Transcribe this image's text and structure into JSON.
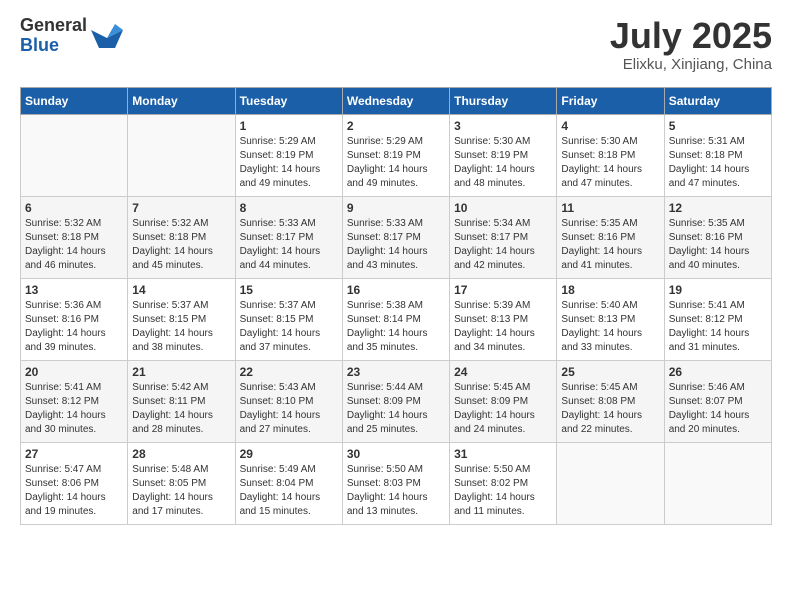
{
  "logo": {
    "general": "General",
    "blue": "Blue"
  },
  "title": "July 2025",
  "location": "Elixku, Xinjiang, China",
  "header_days": [
    "Sunday",
    "Monday",
    "Tuesday",
    "Wednesday",
    "Thursday",
    "Friday",
    "Saturday"
  ],
  "weeks": [
    [
      {
        "day": "",
        "sunrise": "",
        "sunset": "",
        "daylight": ""
      },
      {
        "day": "",
        "sunrise": "",
        "sunset": "",
        "daylight": ""
      },
      {
        "day": "1",
        "sunrise": "Sunrise: 5:29 AM",
        "sunset": "Sunset: 8:19 PM",
        "daylight": "Daylight: 14 hours and 49 minutes."
      },
      {
        "day": "2",
        "sunrise": "Sunrise: 5:29 AM",
        "sunset": "Sunset: 8:19 PM",
        "daylight": "Daylight: 14 hours and 49 minutes."
      },
      {
        "day": "3",
        "sunrise": "Sunrise: 5:30 AM",
        "sunset": "Sunset: 8:19 PM",
        "daylight": "Daylight: 14 hours and 48 minutes."
      },
      {
        "day": "4",
        "sunrise": "Sunrise: 5:30 AM",
        "sunset": "Sunset: 8:18 PM",
        "daylight": "Daylight: 14 hours and 47 minutes."
      },
      {
        "day": "5",
        "sunrise": "Sunrise: 5:31 AM",
        "sunset": "Sunset: 8:18 PM",
        "daylight": "Daylight: 14 hours and 47 minutes."
      }
    ],
    [
      {
        "day": "6",
        "sunrise": "Sunrise: 5:32 AM",
        "sunset": "Sunset: 8:18 PM",
        "daylight": "Daylight: 14 hours and 46 minutes."
      },
      {
        "day": "7",
        "sunrise": "Sunrise: 5:32 AM",
        "sunset": "Sunset: 8:18 PM",
        "daylight": "Daylight: 14 hours and 45 minutes."
      },
      {
        "day": "8",
        "sunrise": "Sunrise: 5:33 AM",
        "sunset": "Sunset: 8:17 PM",
        "daylight": "Daylight: 14 hours and 44 minutes."
      },
      {
        "day": "9",
        "sunrise": "Sunrise: 5:33 AM",
        "sunset": "Sunset: 8:17 PM",
        "daylight": "Daylight: 14 hours and 43 minutes."
      },
      {
        "day": "10",
        "sunrise": "Sunrise: 5:34 AM",
        "sunset": "Sunset: 8:17 PM",
        "daylight": "Daylight: 14 hours and 42 minutes."
      },
      {
        "day": "11",
        "sunrise": "Sunrise: 5:35 AM",
        "sunset": "Sunset: 8:16 PM",
        "daylight": "Daylight: 14 hours and 41 minutes."
      },
      {
        "day": "12",
        "sunrise": "Sunrise: 5:35 AM",
        "sunset": "Sunset: 8:16 PM",
        "daylight": "Daylight: 14 hours and 40 minutes."
      }
    ],
    [
      {
        "day": "13",
        "sunrise": "Sunrise: 5:36 AM",
        "sunset": "Sunset: 8:16 PM",
        "daylight": "Daylight: 14 hours and 39 minutes."
      },
      {
        "day": "14",
        "sunrise": "Sunrise: 5:37 AM",
        "sunset": "Sunset: 8:15 PM",
        "daylight": "Daylight: 14 hours and 38 minutes."
      },
      {
        "day": "15",
        "sunrise": "Sunrise: 5:37 AM",
        "sunset": "Sunset: 8:15 PM",
        "daylight": "Daylight: 14 hours and 37 minutes."
      },
      {
        "day": "16",
        "sunrise": "Sunrise: 5:38 AM",
        "sunset": "Sunset: 8:14 PM",
        "daylight": "Daylight: 14 hours and 35 minutes."
      },
      {
        "day": "17",
        "sunrise": "Sunrise: 5:39 AM",
        "sunset": "Sunset: 8:13 PM",
        "daylight": "Daylight: 14 hours and 34 minutes."
      },
      {
        "day": "18",
        "sunrise": "Sunrise: 5:40 AM",
        "sunset": "Sunset: 8:13 PM",
        "daylight": "Daylight: 14 hours and 33 minutes."
      },
      {
        "day": "19",
        "sunrise": "Sunrise: 5:41 AM",
        "sunset": "Sunset: 8:12 PM",
        "daylight": "Daylight: 14 hours and 31 minutes."
      }
    ],
    [
      {
        "day": "20",
        "sunrise": "Sunrise: 5:41 AM",
        "sunset": "Sunset: 8:12 PM",
        "daylight": "Daylight: 14 hours and 30 minutes."
      },
      {
        "day": "21",
        "sunrise": "Sunrise: 5:42 AM",
        "sunset": "Sunset: 8:11 PM",
        "daylight": "Daylight: 14 hours and 28 minutes."
      },
      {
        "day": "22",
        "sunrise": "Sunrise: 5:43 AM",
        "sunset": "Sunset: 8:10 PM",
        "daylight": "Daylight: 14 hours and 27 minutes."
      },
      {
        "day": "23",
        "sunrise": "Sunrise: 5:44 AM",
        "sunset": "Sunset: 8:09 PM",
        "daylight": "Daylight: 14 hours and 25 minutes."
      },
      {
        "day": "24",
        "sunrise": "Sunrise: 5:45 AM",
        "sunset": "Sunset: 8:09 PM",
        "daylight": "Daylight: 14 hours and 24 minutes."
      },
      {
        "day": "25",
        "sunrise": "Sunrise: 5:45 AM",
        "sunset": "Sunset: 8:08 PM",
        "daylight": "Daylight: 14 hours and 22 minutes."
      },
      {
        "day": "26",
        "sunrise": "Sunrise: 5:46 AM",
        "sunset": "Sunset: 8:07 PM",
        "daylight": "Daylight: 14 hours and 20 minutes."
      }
    ],
    [
      {
        "day": "27",
        "sunrise": "Sunrise: 5:47 AM",
        "sunset": "Sunset: 8:06 PM",
        "daylight": "Daylight: 14 hours and 19 minutes."
      },
      {
        "day": "28",
        "sunrise": "Sunrise: 5:48 AM",
        "sunset": "Sunset: 8:05 PM",
        "daylight": "Daylight: 14 hours and 17 minutes."
      },
      {
        "day": "29",
        "sunrise": "Sunrise: 5:49 AM",
        "sunset": "Sunset: 8:04 PM",
        "daylight": "Daylight: 14 hours and 15 minutes."
      },
      {
        "day": "30",
        "sunrise": "Sunrise: 5:50 AM",
        "sunset": "Sunset: 8:03 PM",
        "daylight": "Daylight: 14 hours and 13 minutes."
      },
      {
        "day": "31",
        "sunrise": "Sunrise: 5:50 AM",
        "sunset": "Sunset: 8:02 PM",
        "daylight": "Daylight: 14 hours and 11 minutes."
      },
      {
        "day": "",
        "sunrise": "",
        "sunset": "",
        "daylight": ""
      },
      {
        "day": "",
        "sunrise": "",
        "sunset": "",
        "daylight": ""
      }
    ]
  ]
}
